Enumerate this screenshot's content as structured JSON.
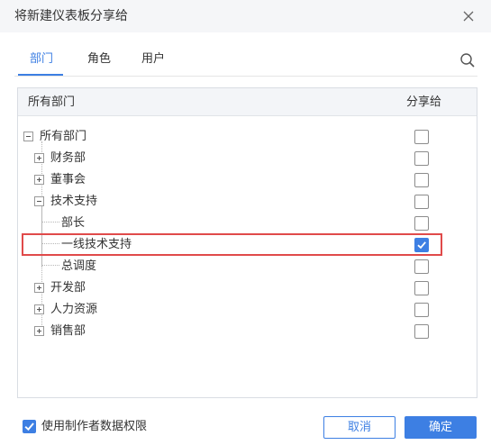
{
  "dialog": {
    "title": "将新建仪表板分享给"
  },
  "tabs": [
    {
      "label": "部门",
      "active": true
    },
    {
      "label": "角色",
      "active": false
    },
    {
      "label": "用户",
      "active": false
    }
  ],
  "table": {
    "col_department": "所有部门",
    "col_share": "分享给"
  },
  "tree": [
    {
      "label": "所有部门",
      "checked": false,
      "expanded": true
    },
    {
      "label": "财务部",
      "checked": false,
      "expanded": false
    },
    {
      "label": "董事会",
      "checked": false,
      "expanded": false
    },
    {
      "label": "技术支持",
      "checked": false,
      "expanded": true
    },
    {
      "label": "部长",
      "checked": false
    },
    {
      "label": "一线技术支持",
      "checked": true
    },
    {
      "label": "总调度",
      "checked": false
    },
    {
      "label": "开发部",
      "checked": false,
      "expanded": false
    },
    {
      "label": "人力资源",
      "checked": false,
      "expanded": false
    },
    {
      "label": "销售部",
      "checked": false,
      "expanded": false
    }
  ],
  "footer": {
    "use_creator_permission_label": "使用制作者数据权限",
    "use_creator_permission_checked": true,
    "cancel_label": "取消",
    "ok_label": "确定"
  },
  "colors": {
    "accent": "#3d7fe3",
    "highlight": "#e04a4a"
  }
}
